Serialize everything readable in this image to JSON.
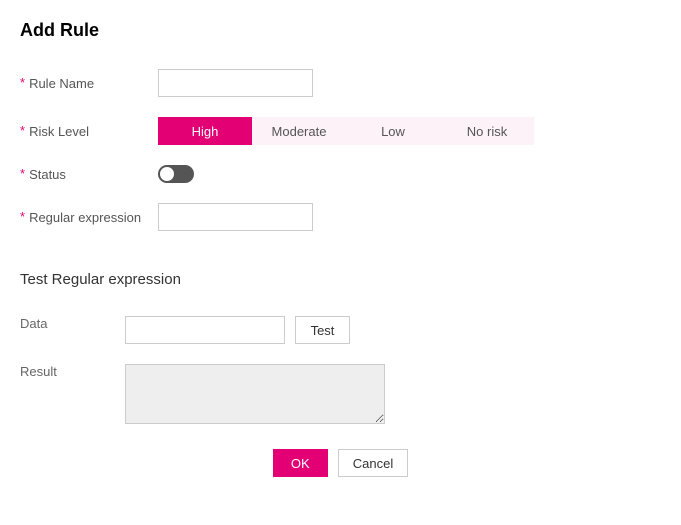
{
  "title": "Add Rule",
  "fields": {
    "rule_name": {
      "label": "Rule Name",
      "value": ""
    },
    "risk_level": {
      "label": "Risk Level",
      "selected": "High",
      "options": [
        "High",
        "Moderate",
        "Low",
        "No risk"
      ]
    },
    "status": {
      "label": "Status",
      "on": false
    },
    "regex": {
      "label": "Regular expression",
      "value": ""
    }
  },
  "test_section": {
    "title": "Test Regular expression",
    "data": {
      "label": "Data",
      "value": ""
    },
    "test_button": "Test",
    "result": {
      "label": "Result",
      "value": ""
    }
  },
  "footer": {
    "ok": "OK",
    "cancel": "Cancel"
  },
  "required_marker": "*"
}
